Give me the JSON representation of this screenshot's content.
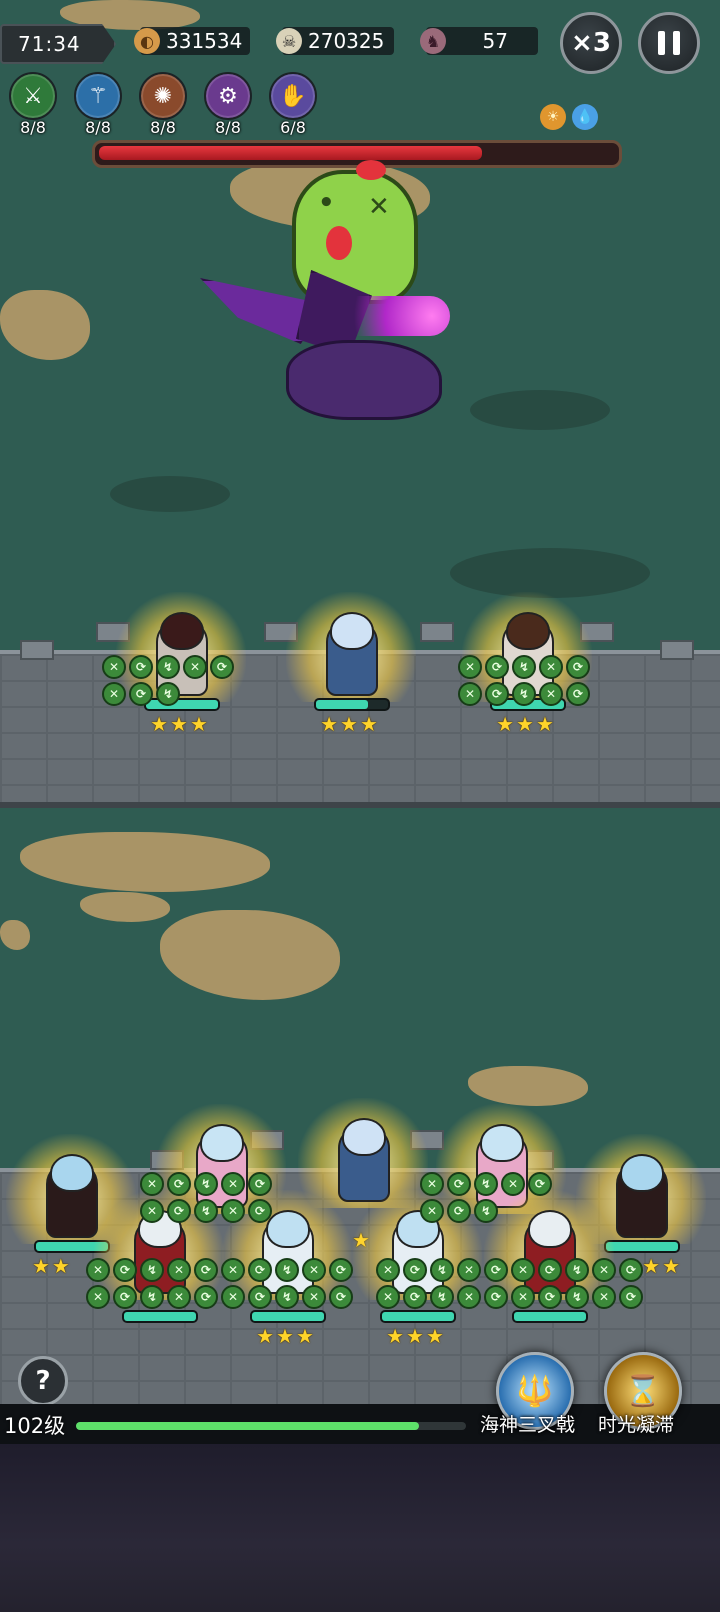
{
  "hud": {
    "timer": "71:34",
    "gold": "331534",
    "kills": "270325",
    "wave": "57",
    "speed_label": "×3"
  },
  "skills": [
    {
      "name": "sword-skill-icon",
      "count": "8/8",
      "color": "#2f7a3a",
      "glyph": "⚔"
    },
    {
      "name": "staff-skill-icon",
      "count": "8/8",
      "color": "#2c6fa8",
      "glyph": "⚚"
    },
    {
      "name": "vortex-skill-icon",
      "count": "8/8",
      "color": "#8a4a2c",
      "glyph": "✺"
    },
    {
      "name": "sigil-skill-icon",
      "count": "8/8",
      "color": "#6a3a8e",
      "glyph": "⚙"
    },
    {
      "name": "claw-skill-icon",
      "count": "6/8",
      "color": "#5a4a9e",
      "glyph": "✋"
    }
  ],
  "boss": {
    "hp_fraction": 0.73
  },
  "heroes": {
    "top": [
      {
        "name": "hero-top-left",
        "stars": "★★★",
        "hp": 1.0
      },
      {
        "name": "hero-top-center",
        "stars": "★★★",
        "hp": 0.72
      },
      {
        "name": "hero-top-right",
        "stars": "★★★",
        "hp": 1.0
      }
    ],
    "bottom": [
      {
        "name": "hero-nun-left",
        "stars": "★★",
        "hp": 1.0
      },
      {
        "name": "hero-twin-left",
        "stars": "",
        "hp": 1.0
      },
      {
        "name": "hero-sage-center",
        "stars": "★",
        "hp": 1.0
      },
      {
        "name": "hero-twin-right",
        "stars": "",
        "hp": 1.0
      },
      {
        "name": "hero-nun-right",
        "stars": "★★",
        "hp": 1.0
      },
      {
        "name": "hero-horned-left",
        "stars": "",
        "hp": 1.0
      },
      {
        "name": "hero-angel-left",
        "stars": "★★★",
        "hp": 1.0
      },
      {
        "name": "hero-angel-right",
        "stars": "★★★",
        "hp": 1.0
      },
      {
        "name": "hero-horned-right",
        "stars": "",
        "hp": 1.0
      }
    ]
  },
  "bottom": {
    "help_label": "?",
    "level_label": "102级",
    "xp_fraction": 0.88,
    "ult_1_label": "海神三叉戟",
    "ult_2_label": "时光凝滞"
  },
  "colors": {
    "grass": "#2f5c52",
    "dirt": "#b79a68",
    "boss_hp": "#e8383f",
    "hero_hp": "#3fd6b0",
    "star": "#ffd42a",
    "xp": "#5ee06a"
  }
}
